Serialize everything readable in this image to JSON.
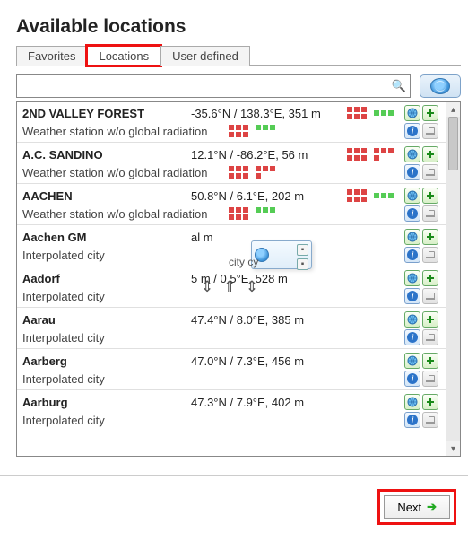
{
  "header": {
    "title": "Available locations"
  },
  "tabs": {
    "favorites": "Favorites",
    "locations": "Locations",
    "user_defined": "User defined"
  },
  "search": {
    "value": "",
    "placeholder": ""
  },
  "locations": [
    {
      "name": "2ND VALLEY FOREST",
      "coords": "-35.6°N / 138.3°E, 351 m",
      "desc": "Weather station w/o global radiation",
      "periods": "rg"
    },
    {
      "name": "A.C. SANDINO",
      "coords": "12.1°N / -86.2°E, 56 m",
      "desc": "Weather station w/o global radiation",
      "periods": "rr"
    },
    {
      "name": "AACHEN",
      "coords": "50.8°N / 6.1°E, 202 m",
      "desc": "Weather station w/o global radiation",
      "periods": "rg"
    },
    {
      "name": "Aachen GM",
      "coords": "al m",
      "desc": "Interpolated city",
      "sub": "city    cy"
    },
    {
      "name": "Aadorf",
      "coords": "5 m / 0.5°E, 528 m",
      "desc": "Interpolated city"
    },
    {
      "name": "Aarau",
      "coords": "47.4°N / 8.0°E, 385 m",
      "desc": "Interpolated city"
    },
    {
      "name": "Aarberg",
      "coords": "47.0°N / 7.3°E, 456 m",
      "desc": "Interpolated city"
    },
    {
      "name": "Aarburg",
      "coords": "47.3°N / 7.9°E, 402 m",
      "desc": "Interpolated city"
    }
  ],
  "footer": {
    "next": "Next"
  }
}
